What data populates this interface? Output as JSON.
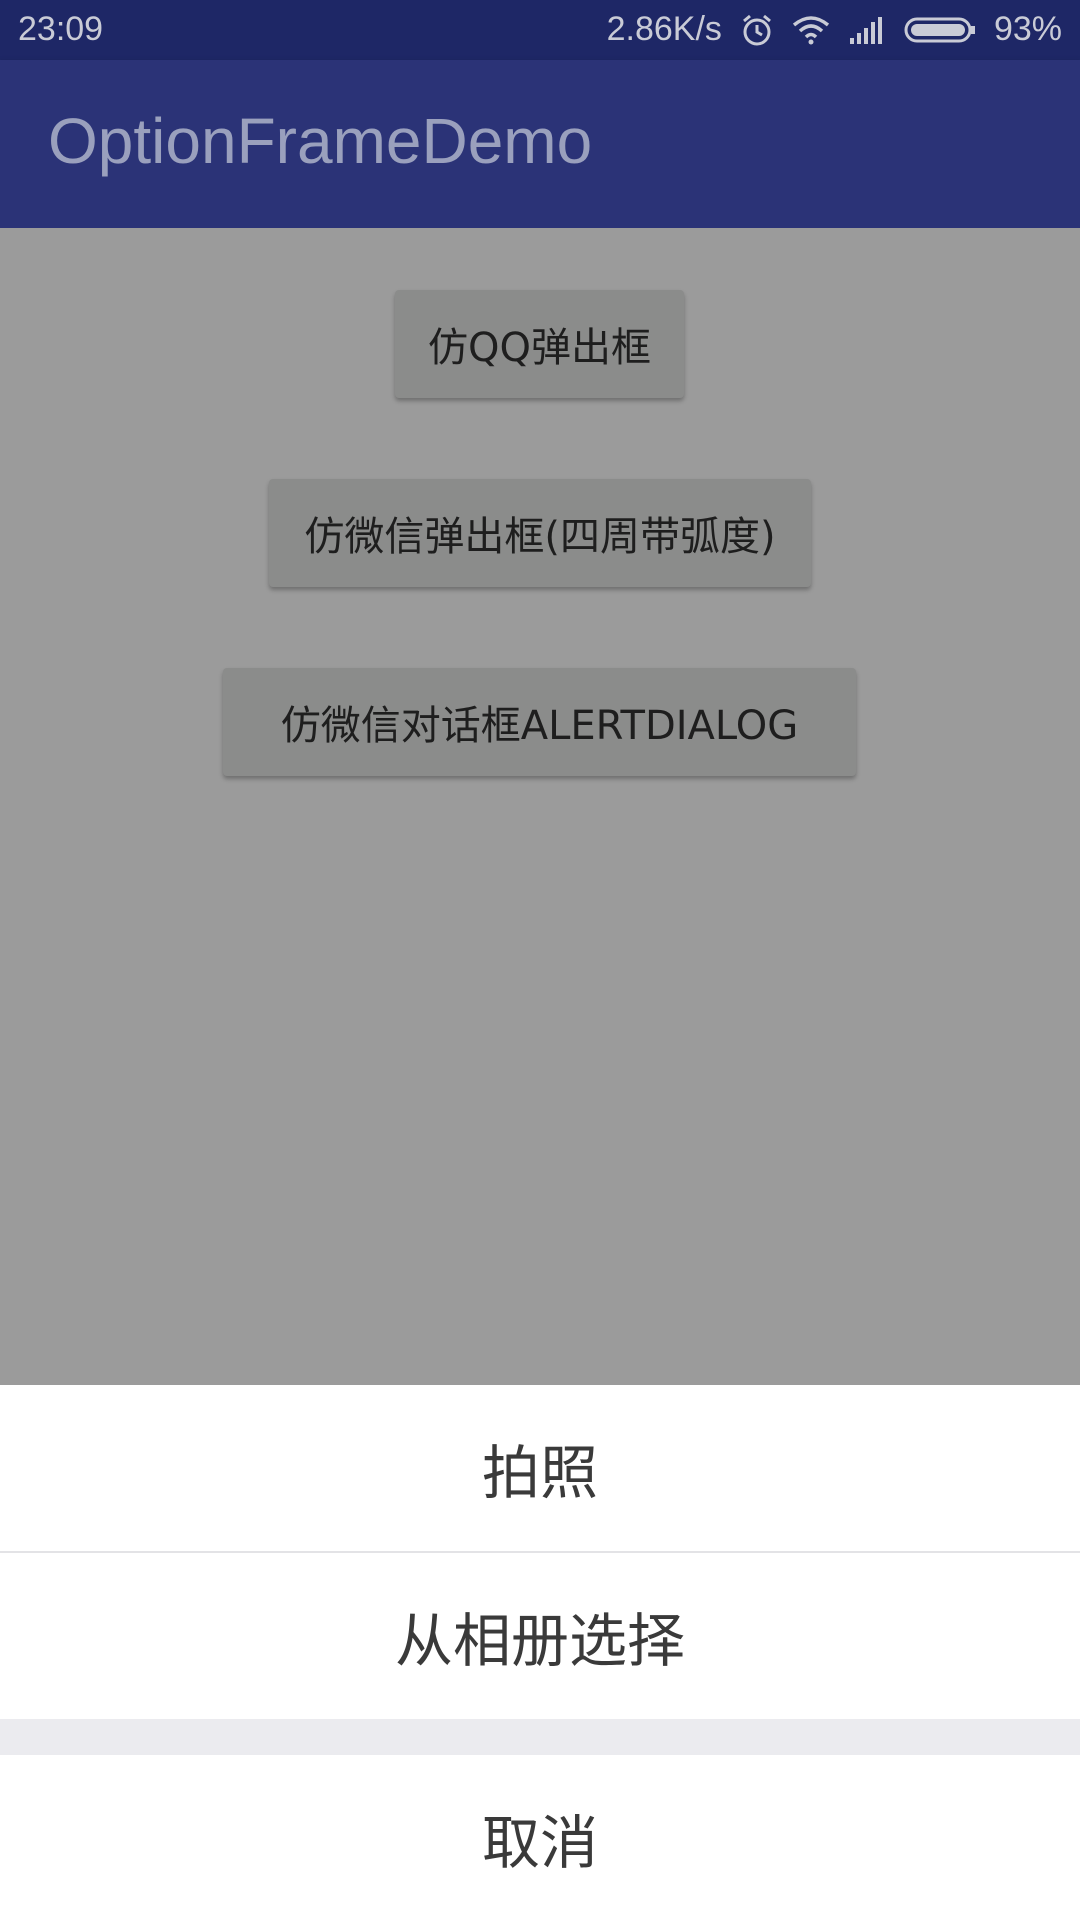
{
  "status_bar": {
    "time": "23:09",
    "network_speed": "2.86K/s",
    "battery": "93%",
    "icons": [
      "alarm-icon",
      "wifi-icon",
      "signal-icon",
      "battery-icon"
    ]
  },
  "app_bar": {
    "title": "OptionFrameDemo"
  },
  "buttons": {
    "qq_popup": "仿QQ弹出框",
    "wechat_popup": "仿微信弹出框(四周带弧度)",
    "wechat_dialog": "仿微信对话框ALERTDIALOG"
  },
  "action_sheet": {
    "take_photo": "拍照",
    "choose_album": "从相册选择",
    "cancel": "取消"
  },
  "colors": {
    "status_bar": "#1e2766",
    "app_bar": "#2b3377",
    "scrim": "#9b9b9b",
    "button": "#8b8c8b",
    "sheet_bg": "#ebebef"
  }
}
